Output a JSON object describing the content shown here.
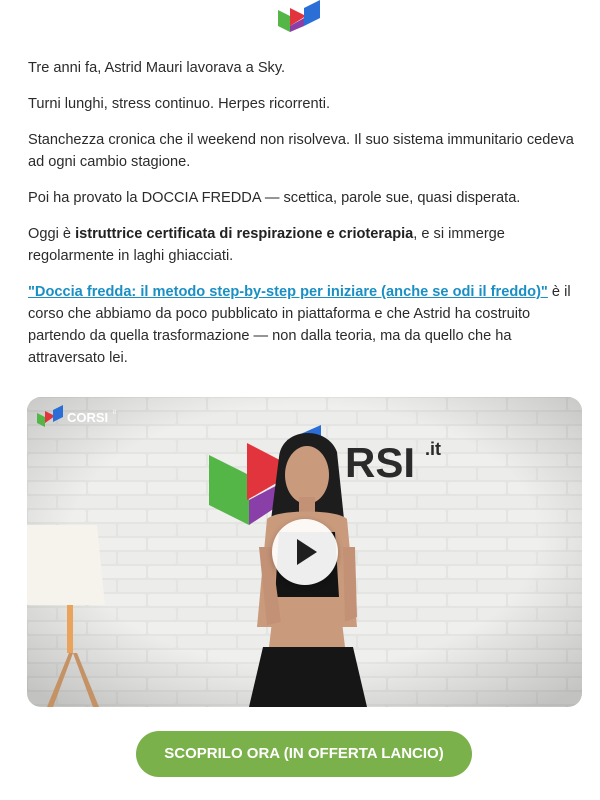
{
  "brand": {
    "logo_icon": "corsi-logo-icon",
    "video_logo_text": "CORSI",
    "video_logo_suffix": "it",
    "wall_sign_text": "RSI",
    "wall_sign_suffix": ".it"
  },
  "body": {
    "p1": "Tre anni fa, Astrid Mauri lavorava a Sky.",
    "p2": "Turni lunghi, stress continuo. Herpes ricorrenti.",
    "p3": "Stanchezza cronica che il weekend non risolveva. Il suo sistema immunitario cedeva ad ogni cambio stagione.",
    "p4": "Poi ha provato la DOCCIA FREDDA — scettica, parole sue, quasi disperata.",
    "p5_prefix": "Oggi è ",
    "p5_bold": "istruttrice certificata di respirazione e crioterapia",
    "p5_suffix": ", e si immerge regolarmente in laghi ghiacciati.",
    "p6_link": "\"Doccia fredda: il metodo step-by-step per iniziare (anche se odi il freddo)\"",
    "p6_suffix": " è il corso che abbiamo da poco pubblicato in piattaforma e che Astrid ha costruito partendo da quella trasformazione — non dalla teoria, ma da quello che ha attraversato lei."
  },
  "video": {
    "play_icon": "play-icon"
  },
  "cta": {
    "label": "SCOPRILO ORA (IN OFFERTA LANCIO)",
    "color": "#7bb14a"
  },
  "colors": {
    "link": "#1a8fc4",
    "logo_red": "#e2343c",
    "logo_green": "#55b648",
    "logo_blue": "#2b6fd6",
    "logo_purple": "#8a3ea8"
  }
}
